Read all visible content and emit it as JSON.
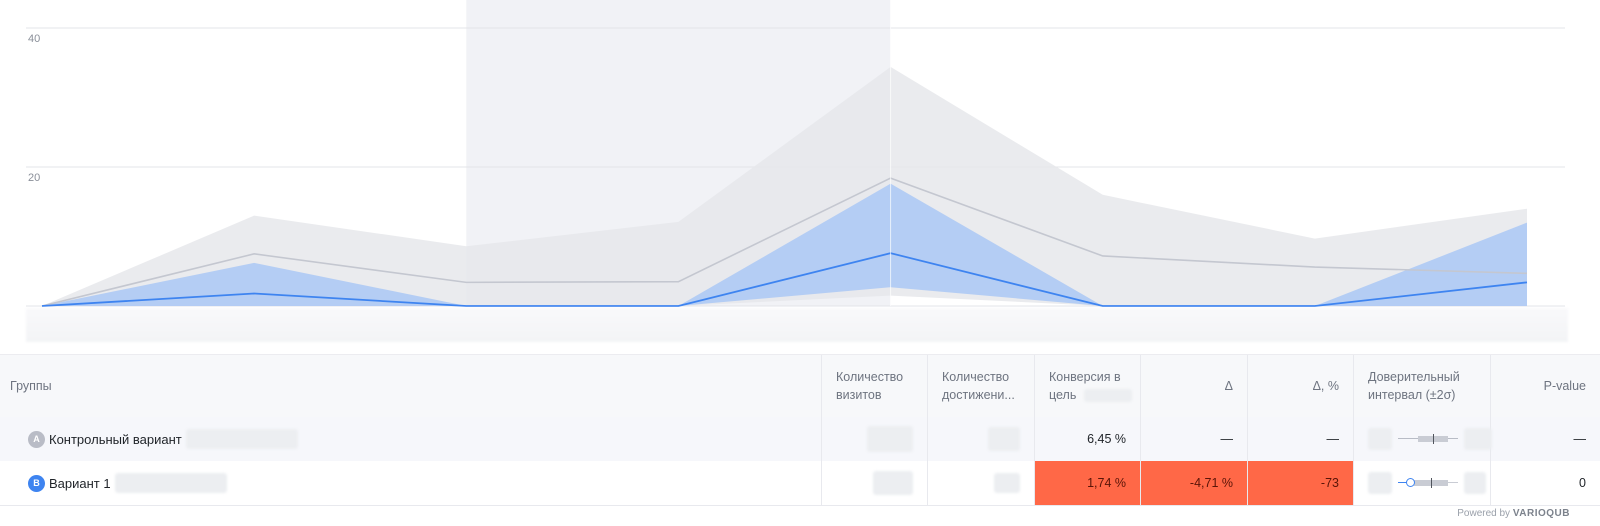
{
  "chart_data": {
    "type": "area",
    "y_ticks": [
      "40",
      "20"
    ],
    "ylim": [
      0,
      40
    ],
    "x": [
      0,
      1,
      2,
      3,
      4,
      5,
      6,
      7
    ],
    "highlight_range": [
      2,
      4
    ],
    "series": [
      {
        "values": [
          0,
          7.5,
          3.4,
          3.5,
          18.4,
          7.2,
          5.6,
          4.7
        ],
        "band_low": [
          0,
          0,
          0,
          0,
          1.5,
          0,
          0,
          0
        ],
        "band_high": [
          0,
          13,
          8.6,
          12.1,
          34.4,
          16,
          9.7,
          14
        ],
        "color": "#c4c7d0",
        "band_color": "#e6e7eb"
      },
      {
        "values": [
          0,
          1.8,
          0,
          0,
          7.6,
          0,
          0,
          3.4
        ],
        "band_low": [
          0,
          0,
          0,
          0,
          2.7,
          0,
          0,
          0
        ],
        "band_high": [
          0,
          6.2,
          0,
          0,
          17.6,
          0,
          0,
          12
        ],
        "color": "#3e84f0",
        "band_color": "#a6c6f5"
      }
    ]
  },
  "table": {
    "headers": {
      "groups": "Группы",
      "visits_1": "Количество",
      "visits_2": "визитов",
      "achievements_1": "Количество",
      "achievements_2": "достижени...",
      "conversion_1": "Конверсия в",
      "conversion_2": "цель",
      "delta": "Δ",
      "delta_pct": "Δ, %",
      "ci_1": "Доверительный",
      "ci_2": "интервал (±2σ)",
      "pvalue": "P-value"
    },
    "rows": [
      {
        "badge": "A",
        "name": "Контрольный вариант",
        "conversion": "6,45 %",
        "delta": "—",
        "delta_pct": "—",
        "pvalue": "—"
      },
      {
        "badge": "B",
        "name": "Вариант 1",
        "conversion": "1,74 %",
        "delta": "-4,71 %",
        "delta_pct": "-73",
        "pvalue": "0"
      }
    ]
  },
  "colors": {
    "danger": "#ff6847",
    "accent": "#3e84f0",
    "control": "#b9bcc6"
  },
  "footer": {
    "powered_prefix": "Powered by",
    "powered_brand": "VARIOQUB"
  }
}
